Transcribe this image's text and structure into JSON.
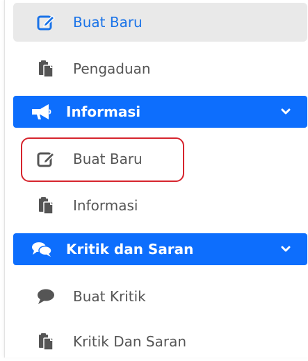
{
  "menu": {
    "items": [
      {
        "label": "Buat Baru",
        "icon": "edit-icon",
        "state": "active"
      },
      {
        "label": "Pengaduan",
        "icon": "clipboard-icon"
      },
      {
        "label": "Informasi",
        "icon": "megaphone-icon",
        "type": "section"
      },
      {
        "label": "Buat Baru",
        "icon": "edit-icon"
      },
      {
        "label": "Informasi",
        "icon": "clipboard-icon"
      },
      {
        "label": "Kritik dan Saran",
        "icon": "comments-icon",
        "type": "section"
      },
      {
        "label": "Buat Kritik",
        "icon": "comment-icon"
      },
      {
        "label": "Kritik Dan Saran",
        "icon": "clipboard-icon"
      }
    ]
  },
  "colors": {
    "accent": "#0d6efd",
    "active_text": "#1a73e8",
    "highlight_border": "#d6242d",
    "text": "#555555"
  }
}
